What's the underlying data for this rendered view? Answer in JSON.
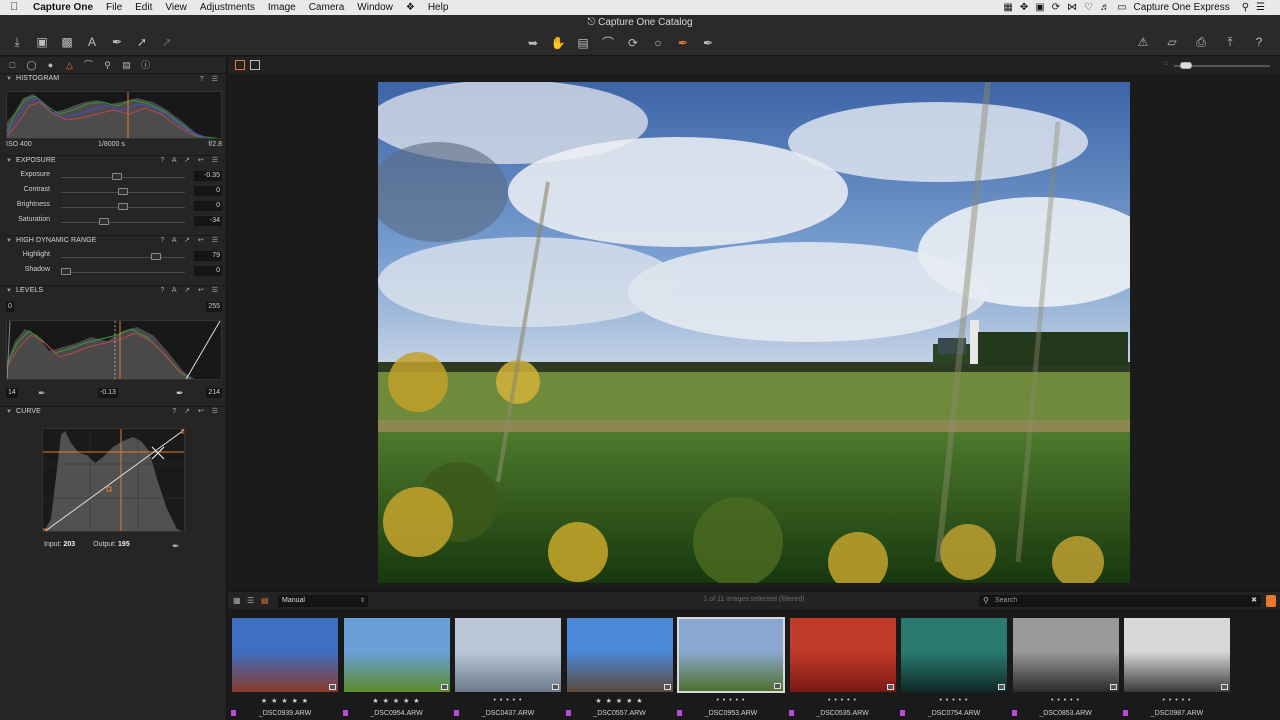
{
  "menubar": {
    "app_name": "Capture One",
    "items": [
      "File",
      "Edit",
      "View",
      "Adjustments",
      "Image",
      "Camera",
      "Window",
      "Help"
    ],
    "right_app": "Capture One Express"
  },
  "window": {
    "title": "Capture One Catalog"
  },
  "left_panel": {
    "histogram": {
      "header": "HISTOGRAM",
      "iso": "ISO 400",
      "shutter": "1/8000 s",
      "aperture": "f/2.8"
    },
    "exposure": {
      "header": "EXPOSURE",
      "rows": [
        {
          "label": "Exposure",
          "value": "-0.35",
          "level": 0.45
        },
        {
          "label": "Contrast",
          "value": "0",
          "level": 0.5
        },
        {
          "label": "Brightness",
          "value": "0",
          "level": 0.5
        },
        {
          "label": "Saturation",
          "value": "-34",
          "level": 0.33
        }
      ]
    },
    "hdr": {
      "header": "HIGH DYNAMIC RANGE",
      "rows": [
        {
          "label": "Highlight",
          "value": "79",
          "level": 0.79
        },
        {
          "label": "Shadow",
          "value": "0",
          "level": 0.0
        }
      ]
    },
    "levels": {
      "header": "LEVELS",
      "top_left": "0",
      "top_right": "255",
      "bottom_left": "14",
      "midpoint": "-0.13",
      "bottom_right": "214"
    },
    "curve": {
      "header": "CURVE",
      "input_label": "Input:",
      "input_value": "203",
      "output_label": "Output:",
      "output_value": "195"
    }
  },
  "browser": {
    "sort_value": "Manual",
    "count_text": "1 of 11 images selected (filtered)",
    "search_placeholder": "Search",
    "accent": "#e8792c",
    "thumbnails": [
      {
        "name": "_DSC0939.ARW",
        "stars": "★ ★ ★ ★ ★"
      },
      {
        "name": "_DSC0954.ARW",
        "stars": "★ ★ ★ ★ ★"
      },
      {
        "name": "_DSC0437.ARW",
        "stars": "• • • • •"
      },
      {
        "name": "_DSC0557.ARW",
        "stars": "★ ★ ★ ★ ★"
      },
      {
        "name": "_DSC0953.ARW",
        "stars": "• • • • •"
      },
      {
        "name": "_DSC0535.ARW",
        "stars": "• • • • •"
      },
      {
        "name": "_DSC0754.ARW",
        "stars": "• • • • •"
      },
      {
        "name": "_DSC0853.ARW",
        "stars": "• • • • •"
      },
      {
        "name": "_DSC0987.ARW",
        "stars": "• • • • •"
      }
    ]
  }
}
